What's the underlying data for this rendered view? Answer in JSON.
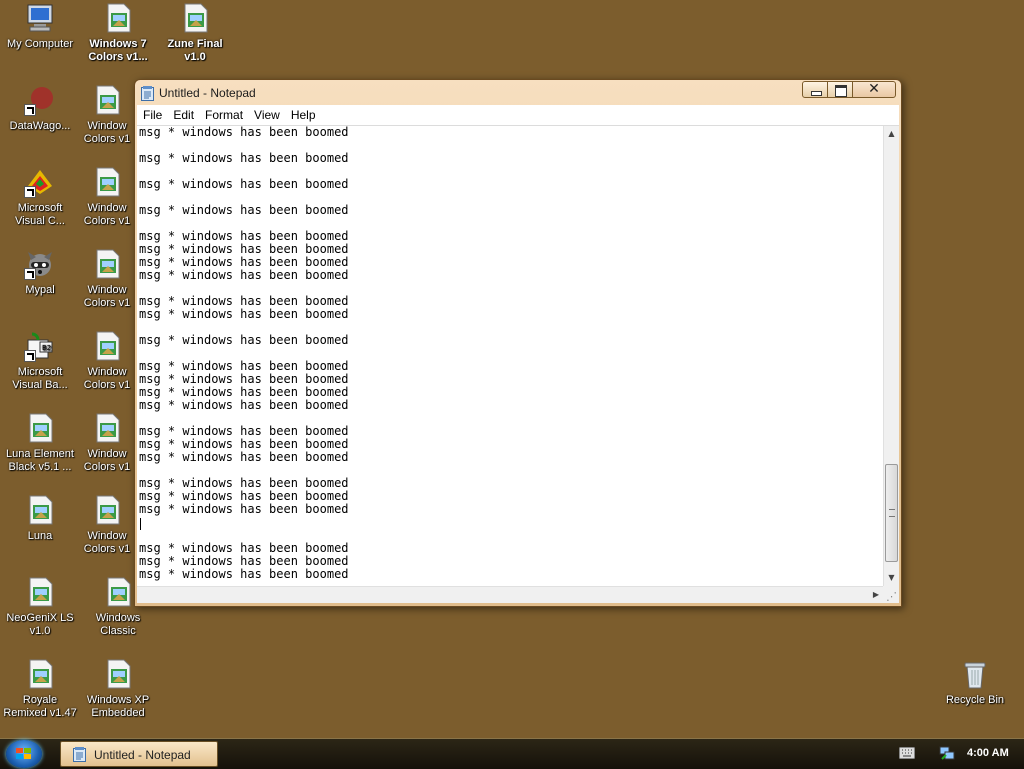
{
  "desktop": {
    "icons": [
      {
        "label": "My Computer",
        "icon": "computer-icon",
        "bold": false
      },
      {
        "label": "Windows 7\nColors v1...",
        "icon": "theme-file-icon",
        "bold": true
      },
      {
        "label": "Zune Final\nv1.0",
        "icon": "theme-file-icon",
        "bold": true
      },
      {
        "label": "DataWago...",
        "icon": "shortcut-app-icon",
        "bold": false
      },
      {
        "label": "Window\nColors v1",
        "icon": "theme-file-icon",
        "bold": false
      },
      {
        "label": "Microsoft\nVisual C...",
        "icon": "visual-c-icon",
        "bold": false
      },
      {
        "label": "Window\nColors v1",
        "icon": "theme-file-icon",
        "bold": false
      },
      {
        "label": "Mypal",
        "icon": "raccoon-icon",
        "bold": false
      },
      {
        "label": "Window\nColors v1",
        "icon": "theme-file-icon",
        "bold": false
      },
      {
        "label": "Microsoft\nVisual Ba...",
        "icon": "visual-basic-icon",
        "bold": false
      },
      {
        "label": "Window\nColors v1",
        "icon": "theme-file-icon",
        "bold": false
      },
      {
        "label": "Luna Element\nBlack v5.1 ...",
        "icon": "theme-file-icon",
        "bold": false
      },
      {
        "label": "Window\nColors v1",
        "icon": "theme-file-icon",
        "bold": false
      },
      {
        "label": "Luna",
        "icon": "theme-file-icon",
        "bold": false
      },
      {
        "label": "Window\nColors v1",
        "icon": "theme-file-icon",
        "bold": false
      },
      {
        "label": "NeoGeniX LS\nv1.0",
        "icon": "theme-file-icon",
        "bold": false
      },
      {
        "label": "Windows\nClassic",
        "icon": "theme-file-icon",
        "bold": false
      },
      {
        "label": "Royale\nRemixed v1.47",
        "icon": "theme-file-icon",
        "bold": false
      },
      {
        "label": "Windows XP\nEmbedded",
        "icon": "theme-file-icon",
        "bold": false
      },
      {
        "label": "Recycle Bin",
        "icon": "recycle-bin-icon",
        "bold": false
      }
    ]
  },
  "notepad": {
    "title": "Untitled - Notepad",
    "close_glyph": "✕",
    "menu": [
      "File",
      "Edit",
      "Format",
      "View",
      "Help"
    ],
    "text": "msg * windows has been boomed\n\nmsg * windows has been boomed\n\nmsg * windows has been boomed\n\nmsg * windows has been boomed\n\nmsg * windows has been boomed\nmsg * windows has been boomed\nmsg * windows has been boomed\nmsg * windows has been boomed\n\nmsg * windows has been boomed\nmsg * windows has been boomed\n\nmsg * windows has been boomed\n\nmsg * windows has been boomed\nmsg * windows has been boomed\nmsg * windows has been boomed\nmsg * windows has been boomed\n\nmsg * windows has been boomed\nmsg * windows has been boomed\nmsg * windows has been boomed\n\nmsg * windows has been boomed\nmsg * windows has been boomed\nmsg * windows has been boomed\n\n\nmsg * windows has been boomed\nmsg * windows has been boomed\nmsg * windows has been boomed",
    "scrollbar_glyphs": {
      "up": "▲",
      "down": "▼",
      "right": "▶"
    }
  },
  "taskbar": {
    "task_label": "Untitled - Notepad",
    "clock": "4:00 AM"
  },
  "colors": {
    "desktop": "#7c5d2d",
    "window_frame": "#e9c99b",
    "taskbar": "#1d180d"
  }
}
